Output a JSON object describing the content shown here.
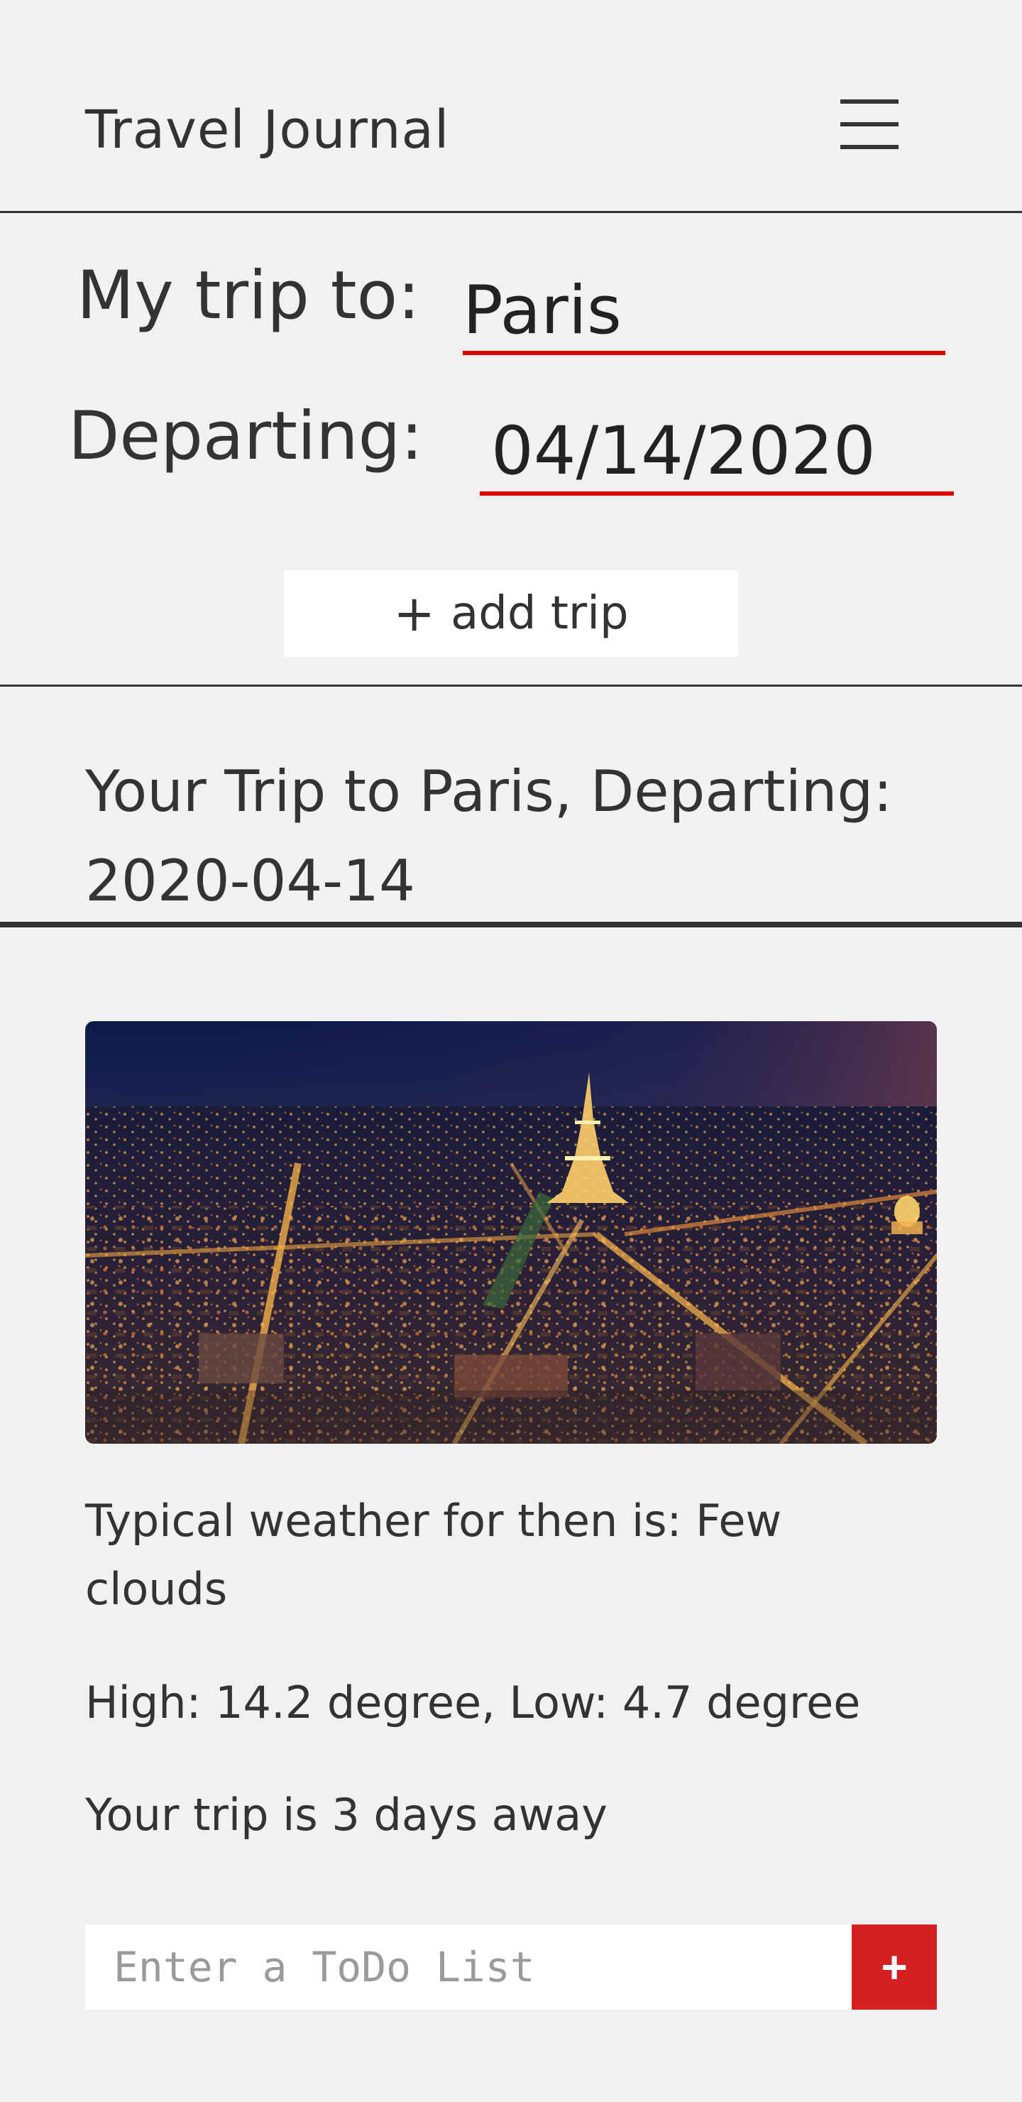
{
  "header": {
    "title": "Travel Journal",
    "menu_icon": "hamburger-menu-icon"
  },
  "form": {
    "destination_label": "My trip to:",
    "destination_value": "Paris",
    "date_label": "Departing:",
    "date_value": "04/14/2020",
    "add_button_icon": "+",
    "add_button_label": "add trip"
  },
  "trip": {
    "heading": "Your Trip to Paris, Departing: 2020-04-14",
    "image_alt": "Paris at night with Eiffel Tower",
    "weather": "Typical weather for then is: Few clouds",
    "temperatures": "High: 14.2 degree, Low: 4.7 degree",
    "countdown": "Your trip is 3 days away"
  },
  "todo": {
    "placeholder": "Enter a ToDo List",
    "add_icon": "+"
  },
  "colors": {
    "background": "#f1f1f1",
    "text": "#333333",
    "accent": "#e00000",
    "todo_button": "#d42020"
  }
}
